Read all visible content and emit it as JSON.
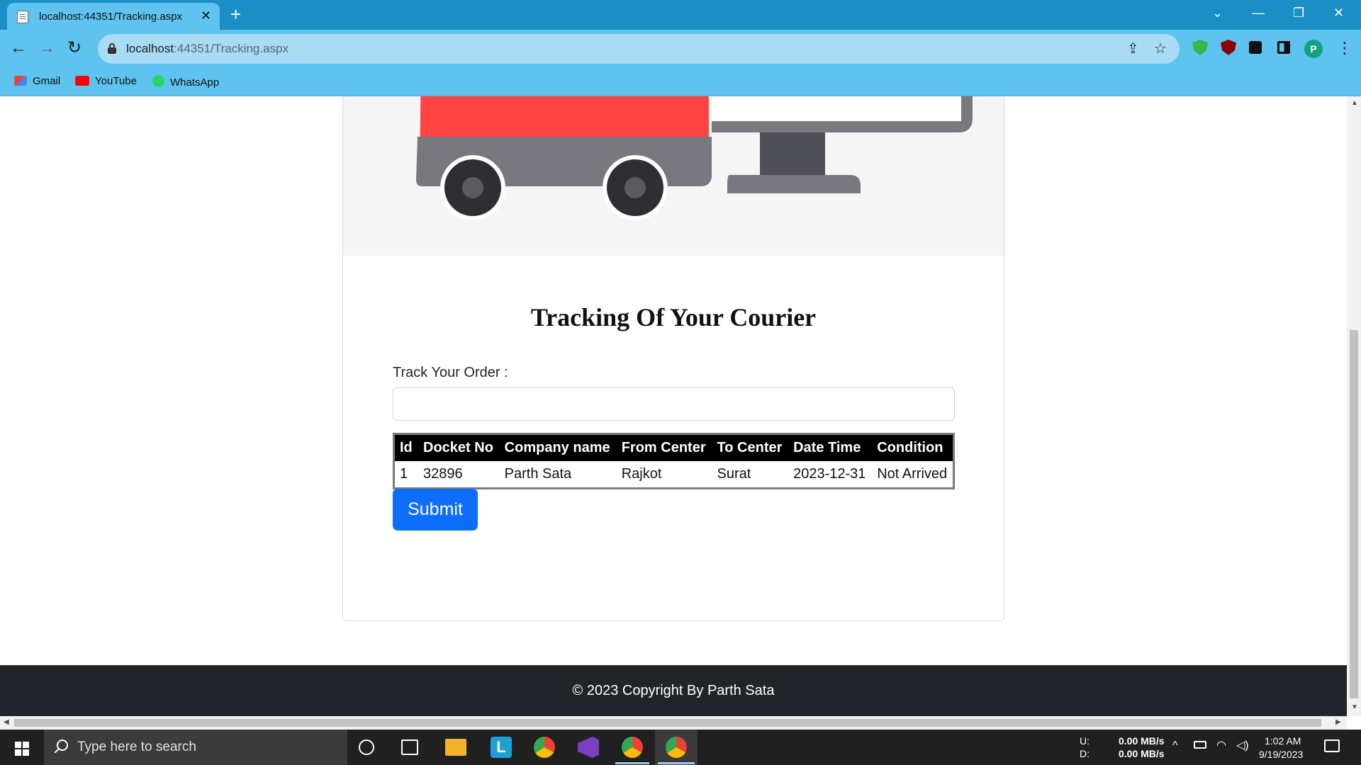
{
  "browser": {
    "tab_title": "localhost:44351/Tracking.aspx",
    "tab_close": "✕",
    "new_tab": "+",
    "url_host": "localhost",
    "url_rest": ":44351/Tracking.aspx",
    "bookmarks": [
      "Gmail",
      "YouTube",
      "WhatsApp"
    ],
    "profile_initial": "P"
  },
  "page": {
    "title": "Tracking Of Your Courier",
    "track_label": "Track Your Order :",
    "track_value": "",
    "submit_label": "Submit",
    "footer": "© 2023 Copyright By Parth Sata"
  },
  "table": {
    "headers": [
      "Id",
      "Docket No",
      "Company name",
      "From Center",
      "To Center",
      "Date Time",
      "Condition"
    ],
    "rows": [
      [
        "1",
        "32896",
        "Parth Sata",
        "Rajkot",
        "Surat",
        "2023-12-31",
        "Not Arrived"
      ]
    ]
  },
  "taskbar": {
    "search_placeholder": "Type here to search",
    "net_up_label": "U:",
    "net_down_label": "D:",
    "net_up": "0.00 MB/s",
    "net_down": "0.00 MB/s",
    "time": "1:02 AM",
    "date": "9/19/2023"
  },
  "colors": {
    "chrome_dark": "#1a8ec5",
    "chrome_light": "#5ec3ef",
    "submit": "#0d6efd",
    "footer": "#212529",
    "truck_red": "#ff4444"
  }
}
